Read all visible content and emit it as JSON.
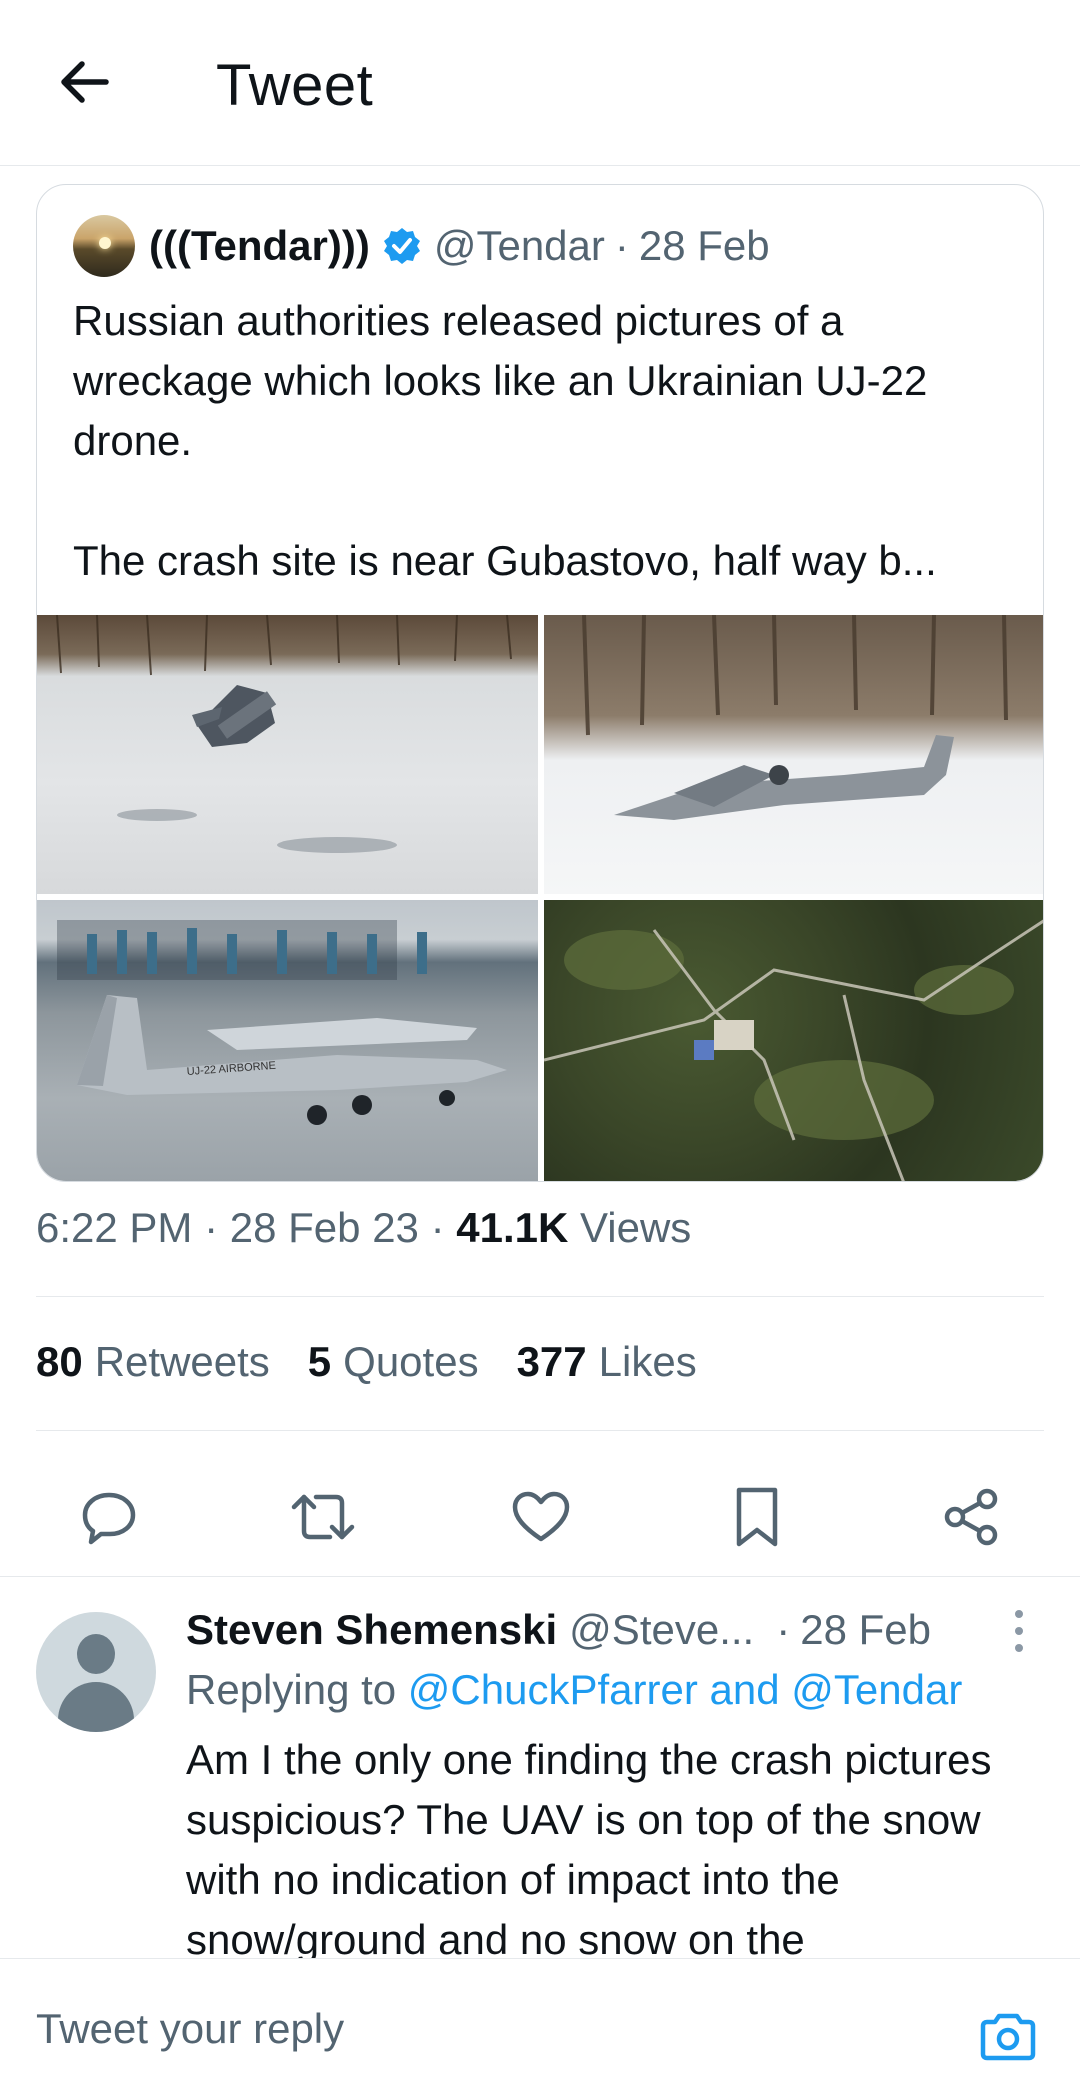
{
  "header": {
    "title": "Tweet"
  },
  "quoted_tweet": {
    "name": "(((Tendar)))",
    "handle": "@Tendar",
    "dot": "·",
    "date": "28 Feb",
    "text_line1": "Russian authorities released pictures of a wreckage which looks like an Ukrainian UJ-22 drone.",
    "text_line2": "The crash site is near Gubastovo, half way b...",
    "images": [
      "crash-wreckage-photo",
      "crash-wreckage-photo-2",
      "uj22-drone-photo",
      "satellite-map-photo"
    ]
  },
  "meta": {
    "time": "6:22 PM",
    "dot1": "·",
    "date": "28 Feb 23",
    "dot2": "·",
    "views_count": "41.1K",
    "views_label": "Views"
  },
  "stats": {
    "retweets_count": "80",
    "retweets_label": "Retweets",
    "quotes_count": "5",
    "quotes_label": "Quotes",
    "likes_count": "377",
    "likes_label": "Likes"
  },
  "actions": [
    "reply-icon",
    "retweet-icon",
    "like-icon",
    "bookmark-icon",
    "share-icon"
  ],
  "reply": {
    "name": "Steven Shemenski",
    "handle": "@Steve...",
    "dot": "·",
    "date": "28 Feb",
    "replying_prefix": "Replying to",
    "replying_mentions": "@ChuckPfarrer and @Tendar",
    "text": "Am I the only one finding the crash pictures suspicious? The UAV is on top of the snow with no indication of impact into the snow/ground and no snow on the"
  },
  "composer": {
    "placeholder": "Tweet your reply"
  },
  "colors": {
    "accent": "#1d9bf0",
    "text": "#0f1419",
    "secondary": "#536471"
  }
}
